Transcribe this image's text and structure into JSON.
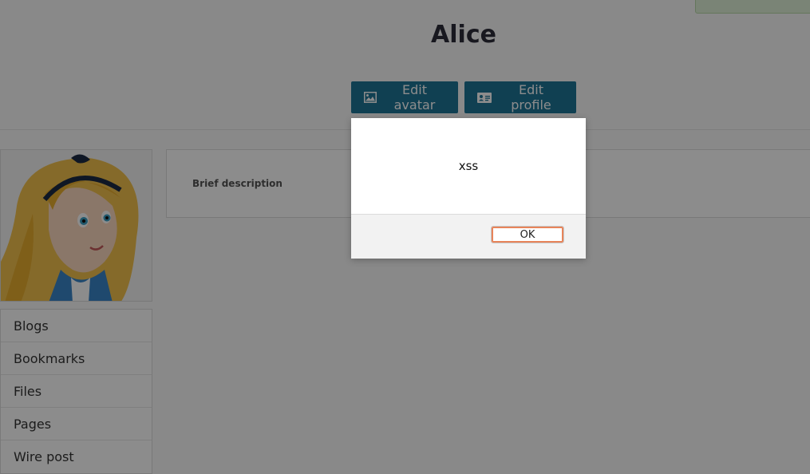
{
  "profile": {
    "name": "Alice"
  },
  "actions": {
    "edit_avatar": "Edit avatar",
    "edit_profile": "Edit profile"
  },
  "details": {
    "brief_description_label": "Brief description"
  },
  "sidebar": {
    "items": [
      {
        "label": "Blogs"
      },
      {
        "label": "Bookmarks"
      },
      {
        "label": "Files"
      },
      {
        "label": "Pages"
      },
      {
        "label": "Wire post"
      }
    ]
  },
  "dialog": {
    "message": "xss",
    "ok_label": "OK"
  },
  "colors": {
    "accent": "#1e7596",
    "overlay": "rgba(0,0,0,0.45)",
    "ok_focus": "#e8845a"
  },
  "icons": {
    "edit_avatar": "image-icon",
    "edit_profile": "id-card-icon"
  }
}
